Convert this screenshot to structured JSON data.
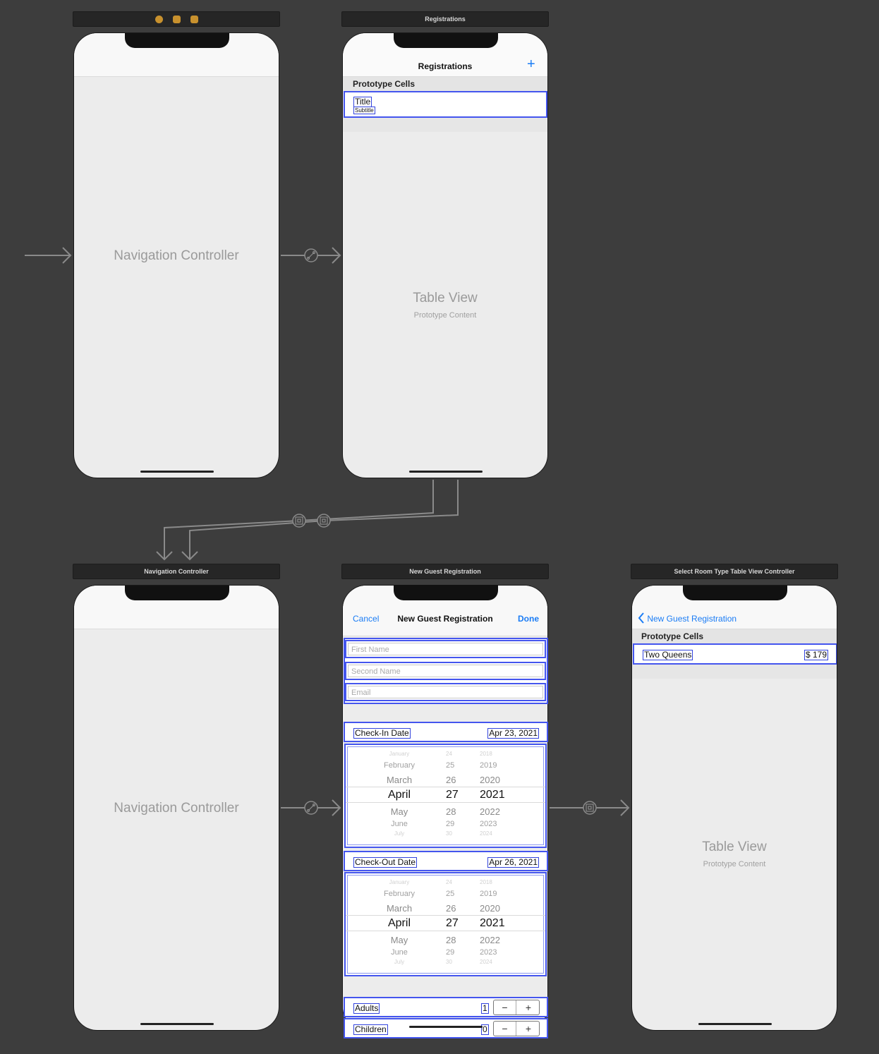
{
  "scenes": {
    "nav1": {
      "title_icons": [
        "back-icon",
        "cube-icon",
        "exit-icon"
      ],
      "center_label": "Navigation Controller"
    },
    "registrations": {
      "scene_title": "Registrations",
      "nav_title": "Registrations",
      "add_label": "+",
      "section_header": "Prototype Cells",
      "cell_title": "Title",
      "cell_subtitle": "Subtitle",
      "center_label": "Table View",
      "center_sublabel": "Prototype Content"
    },
    "nav2": {
      "scene_title": "Navigation Controller",
      "center_label": "Navigation Controller"
    },
    "new_guest": {
      "scene_title": "New Guest Registration",
      "cancel_label": "Cancel",
      "nav_title": "New Guest Registration",
      "done_label": "Done",
      "first_name_placeholder": "First Name",
      "second_name_placeholder": "Second Name",
      "email_placeholder": "Email",
      "checkin_label": "Check-In Date",
      "checkin_value": "Apr 23, 2021",
      "checkout_label": "Check-Out Date",
      "checkout_value": "Apr 26, 2021",
      "picker_rows": [
        {
          "month": "January",
          "day": "24",
          "year": "2018"
        },
        {
          "month": "February",
          "day": "25",
          "year": "2019"
        },
        {
          "month": "March",
          "day": "26",
          "year": "2020"
        },
        {
          "month": "April",
          "day": "27",
          "year": "2021"
        },
        {
          "month": "May",
          "day": "28",
          "year": "2022"
        },
        {
          "month": "June",
          "day": "29",
          "year": "2023"
        },
        {
          "month": "July",
          "day": "30",
          "year": "2024"
        }
      ],
      "adults_label": "Adults",
      "adults_value": "1",
      "children_label": "Children",
      "children_value": "0",
      "stepper_minus": "−",
      "stepper_plus": "+"
    },
    "room_type": {
      "scene_title": "Select Room Type Table View Controller",
      "back_label": "New Guest Registration",
      "section_header": "Prototype Cells",
      "cell_name": "Two Queens",
      "cell_price": "$ 179",
      "center_label": "Table View",
      "center_sublabel": "Prototype Content"
    }
  },
  "colors": {
    "canvas": "#3d3d3d",
    "accent": "#1a7cf5",
    "selection": "#4455ee",
    "connector": "#8a8a8a"
  }
}
